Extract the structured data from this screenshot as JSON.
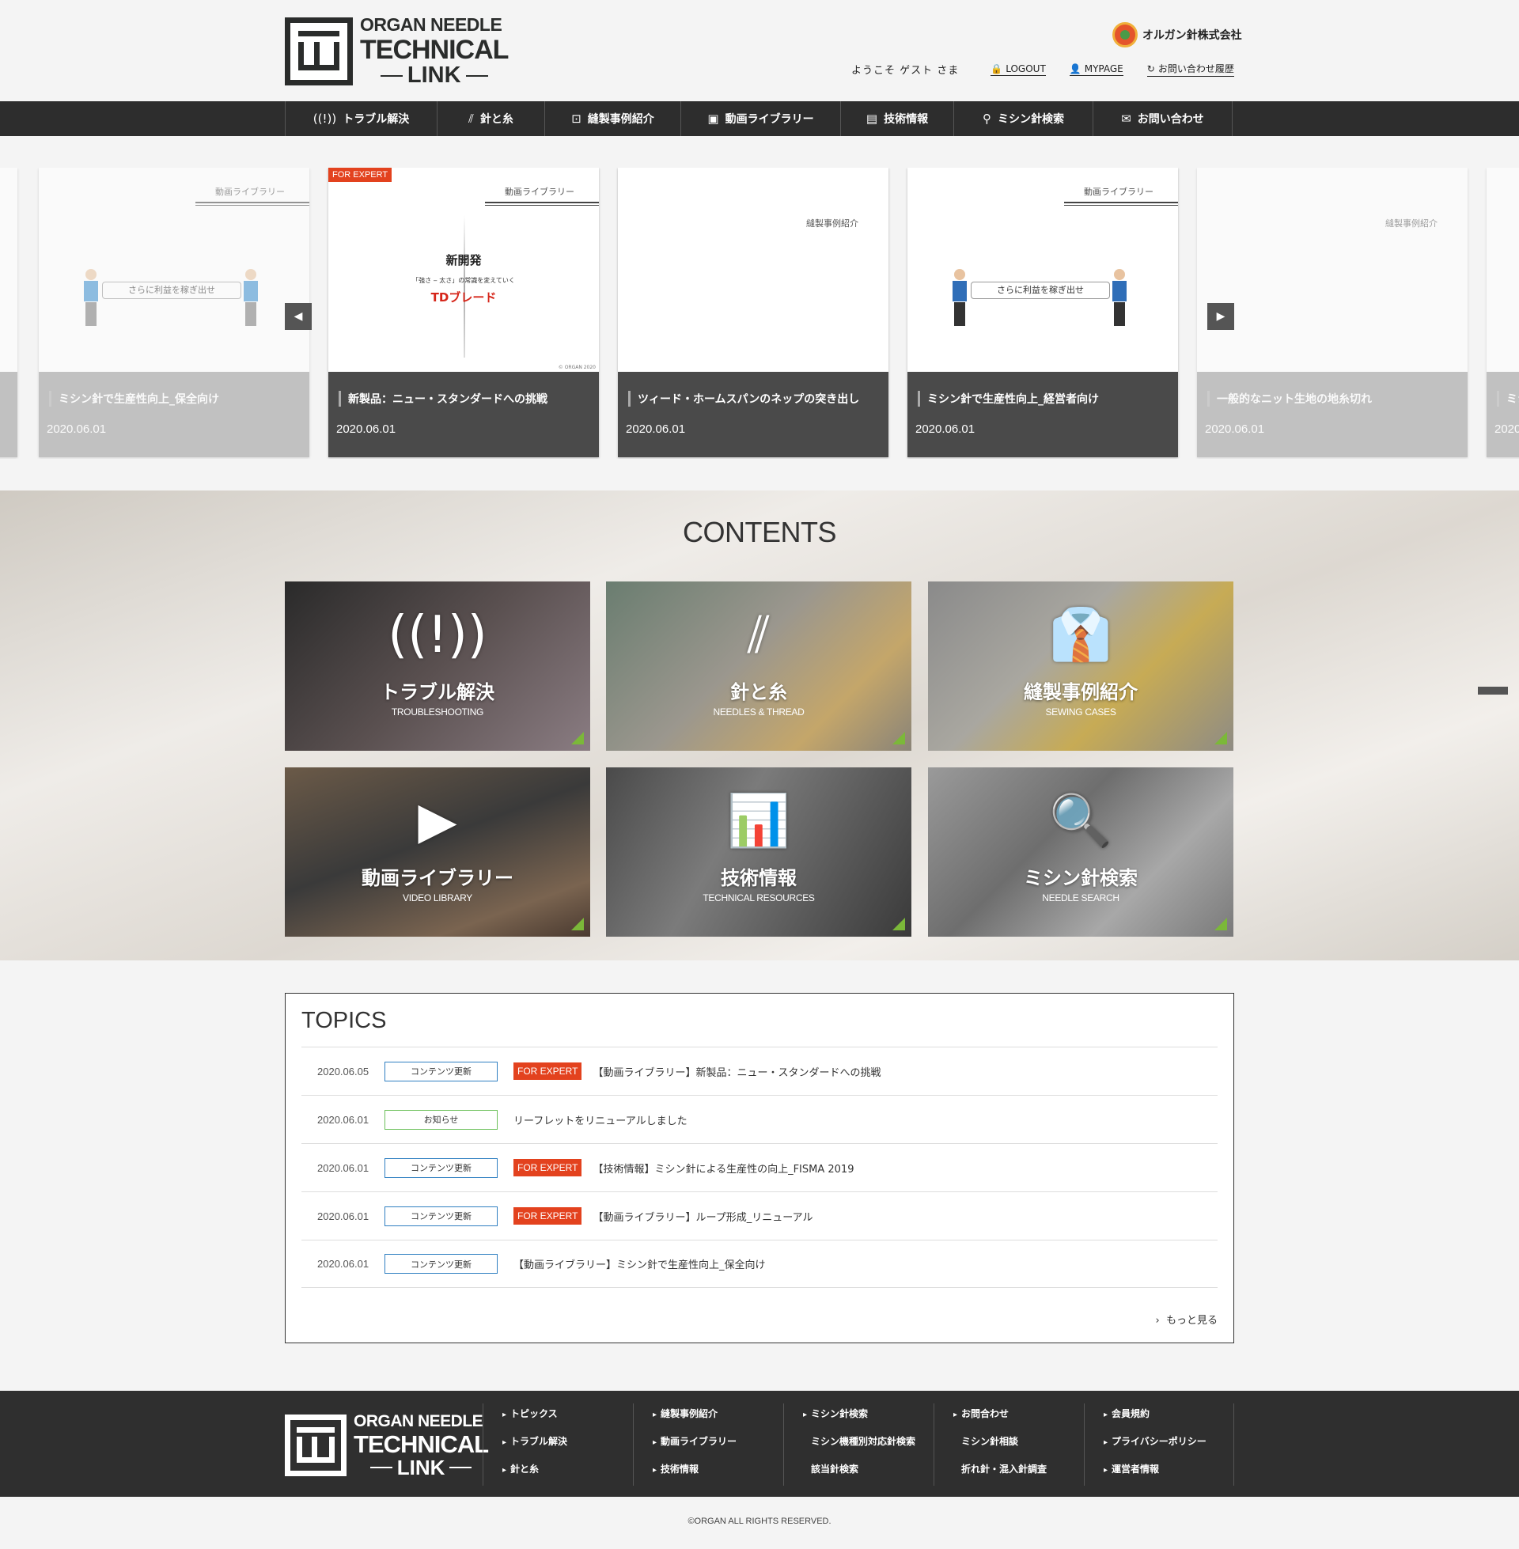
{
  "header": {
    "logo": {
      "line1": "ORGAN NEEDLE",
      "line2": "TECHNICAL",
      "line3": "LINK"
    },
    "company": "オルガン針株式会社",
    "welcome": "ようこそ ゲスト さま",
    "links": [
      {
        "label": "LOGOUT",
        "icon": "lock-icon"
      },
      {
        "label": "MYPAGE",
        "icon": "user-icon"
      },
      {
        "label": "お問い合わせ履歴",
        "icon": "history-icon"
      }
    ]
  },
  "nav": [
    {
      "label": "トラブル解決",
      "icon": "alert-icon"
    },
    {
      "label": "針と糸",
      "icon": "needle-thread-icon"
    },
    {
      "label": "縫製事例紹介",
      "icon": "shirt-icon"
    },
    {
      "label": "動画ライブラリー",
      "icon": "video-icon"
    },
    {
      "label": "技術情報",
      "icon": "document-chart-icon"
    },
    {
      "label": "ミシン針検索",
      "icon": "search-icon"
    },
    {
      "label": "お問い合わせ",
      "icon": "mail-icon"
    }
  ],
  "carousel": {
    "cards": [
      {
        "title": "ミシン針で生産性向上_保全向け",
        "date": "2020.06.01",
        "label": "動画ライブラリー",
        "banner": "さらに利益を稼ぎ出せ"
      },
      {
        "title": "新製品：ニュー・スタンダードへの挑戦",
        "date": "2020.06.01",
        "label": "動画ライブラリー",
        "badge": "FOR EXPERT",
        "img_title": "新開発",
        "img_sub": "「強さ ‒ 太さ」の常識を変えていく",
        "img_brand": "TDブレード",
        "img_copy": "© ORGAN 2020"
      },
      {
        "title": "ツィード・ホームスパンのネップの突き出し",
        "date": "2020.06.01",
        "label": "縫製事例紹介"
      },
      {
        "title": "ミシン針で生産性向上_経営者向け",
        "date": "2020.06.01",
        "label": "動画ライブラリー",
        "banner": "さらに利益を稼ぎ出せ"
      },
      {
        "title": "一般的なニット生地の地糸切れ",
        "date": "2020.06.01",
        "label": "縫製事例紹介"
      }
    ],
    "partial_right_title": "ミシ",
    "partial_right_date": "2020",
    "prev": "◀",
    "next": "▶"
  },
  "contents": {
    "heading": "CONTENTS",
    "tiles": [
      {
        "jp": "トラブル解決",
        "en": "TROUBLESHOOTING",
        "icon": "alert-icon",
        "glyph": "((!))"
      },
      {
        "jp": "針と糸",
        "en": "NEEDLES & THREAD",
        "icon": "needle-thread-icon",
        "glyph": "⫽"
      },
      {
        "jp": "縫製事例紹介",
        "en": "SEWING CASES",
        "icon": "shirt-icon",
        "glyph": "👔"
      },
      {
        "jp": "動画ライブラリー",
        "en": "VIDEO LIBRARY",
        "icon": "video-icon",
        "glyph": "▶"
      },
      {
        "jp": "技術情報",
        "en": "TECHNICAL RESOURCES",
        "icon": "document-chart-icon",
        "glyph": "📊"
      },
      {
        "jp": "ミシン針検索",
        "en": "NEEDLE SEARCH",
        "icon": "search-icon",
        "glyph": "🔍"
      }
    ]
  },
  "topics": {
    "heading": "TOPICS",
    "rows": [
      {
        "date": "2020.06.05",
        "category": "コンテンツ更新",
        "expert": "FOR EXPERT",
        "title": "【動画ライブラリー】新製品：ニュー・スタンダードへの挑戦"
      },
      {
        "date": "2020.06.01",
        "category": "お知らせ",
        "expert": "",
        "title": "リーフレットをリニューアルしました"
      },
      {
        "date": "2020.06.01",
        "category": "コンテンツ更新",
        "expert": "FOR EXPERT",
        "title": "【技術情報】ミシン針による生産性の向上_FISMA 2019"
      },
      {
        "date": "2020.06.01",
        "category": "コンテンツ更新",
        "expert": "FOR EXPERT",
        "title": "【動画ライブラリー】ループ形成_リニューアル"
      },
      {
        "date": "2020.06.01",
        "category": "コンテンツ更新",
        "expert": "",
        "title": "【動画ライブラリー】ミシン針で生産性向上_保全向け"
      }
    ],
    "more": "もっと見る"
  },
  "footer": {
    "cols": [
      [
        "トピックス",
        "トラブル解決",
        "針と糸"
      ],
      [
        "縫製事例紹介",
        "動画ライブラリー",
        "技術情報"
      ],
      [
        "ミシン針検索",
        "ミシン機種別対応針検索",
        "該当針検索"
      ],
      [
        "お問合わせ",
        "ミシン針相談",
        "折れ針・混入針調査"
      ],
      [
        "会員規約",
        "プライバシーポリシー",
        "運営者情報"
      ]
    ],
    "copyright": "©ORGAN ALL RIGHTS RESERVED."
  }
}
